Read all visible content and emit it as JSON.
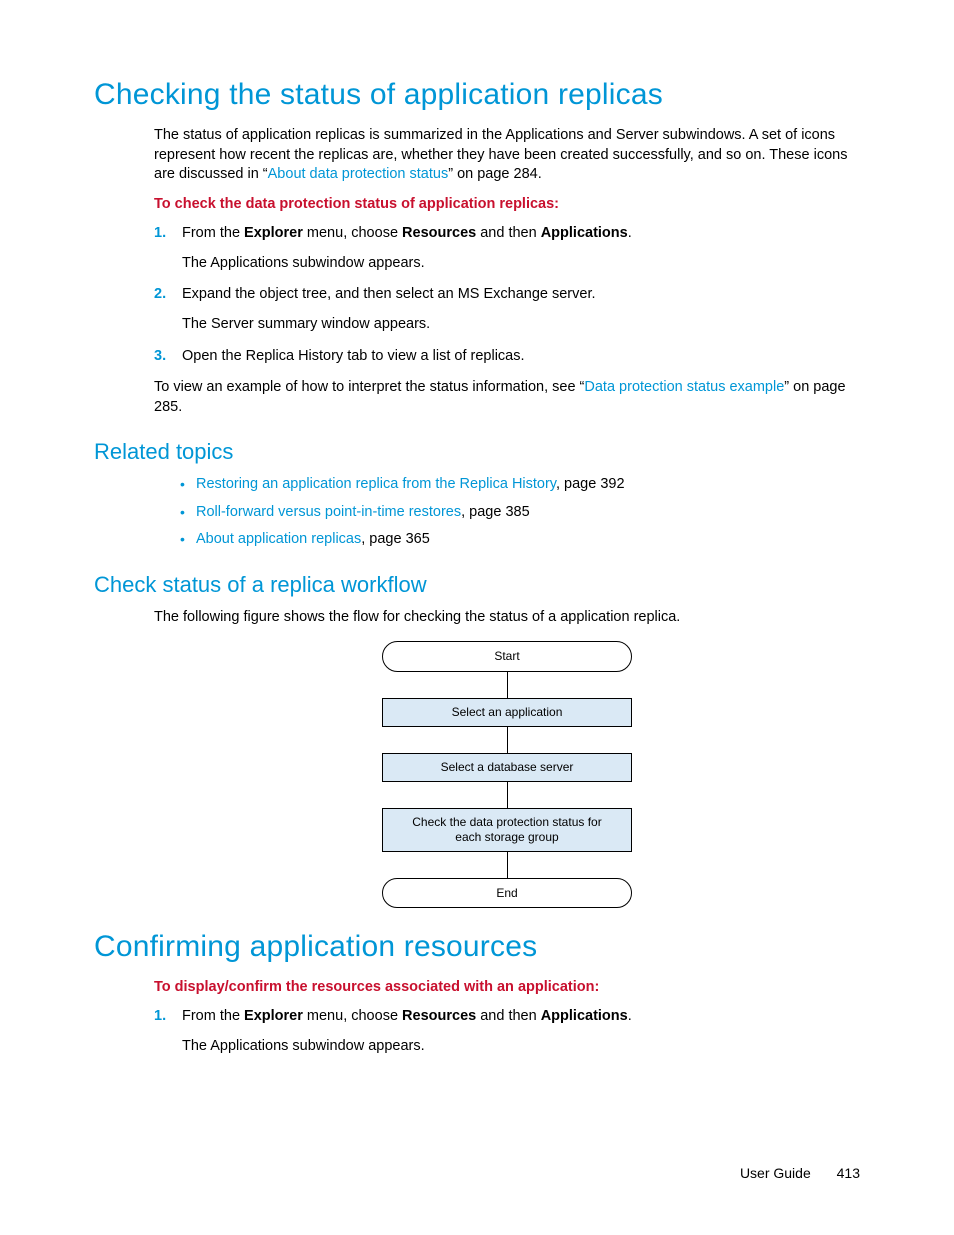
{
  "sec1": {
    "title": "Checking the status of application replicas",
    "intro_pre": "The status of application replicas is summarized in the Applications and Server subwindows. A set of icons represent how recent the replicas are, whether they have been created successfully, and so on. These icons are discussed in “",
    "intro_link": "About data protection status",
    "intro_post": "” on page 284.",
    "lead_in": "To check the data protection status of application replicas:",
    "steps": [
      {
        "num": "1.",
        "text_pre": "From the ",
        "bold1": "Explorer",
        "text_mid1": " menu, choose ",
        "bold2": "Resources",
        "text_mid2": " and then ",
        "bold3": "Applications",
        "text_post": ".",
        "result": "The Applications subwindow appears."
      },
      {
        "num": "2.",
        "text": "Expand the object tree, and then select an MS Exchange server.",
        "result": "The Server summary window appears."
      },
      {
        "num": "3.",
        "text": "Open the Replica History tab to view a list of replicas."
      }
    ],
    "closing_pre": "To view an example of how to interpret the status information, see “",
    "closing_link": "Data protection status example",
    "closing_post": "” on page 285."
  },
  "related": {
    "title": "Related topics",
    "items": [
      {
        "link": "Restoring an application replica from the Replica History",
        "suffix": ", page 392"
      },
      {
        "link": "Roll-forward versus point-in-time restores",
        "suffix": ", page 385"
      },
      {
        "link": "About application replicas",
        "suffix": ", page 365"
      }
    ]
  },
  "workflow": {
    "title": "Check status of a replica workflow",
    "intro": "The following figure shows the flow for checking the status of a application replica.",
    "nodes": {
      "start": "Start",
      "n1": "Select an application",
      "n2": "Select a database server",
      "n3": "Check the data protection status for each storage group",
      "end": "End"
    }
  },
  "sec2": {
    "title": "Confirming application resources",
    "lead_in": "To display/confirm the resources associated with an application:",
    "steps": [
      {
        "num": "1.",
        "text_pre": "From the ",
        "bold1": "Explorer",
        "text_mid1": " menu, choose ",
        "bold2": "Resources",
        "text_mid2": " and then ",
        "bold3": "Applications",
        "text_post": ".",
        "result": "The Applications subwindow appears."
      }
    ]
  },
  "footer": {
    "label": "User Guide",
    "page": "413"
  }
}
